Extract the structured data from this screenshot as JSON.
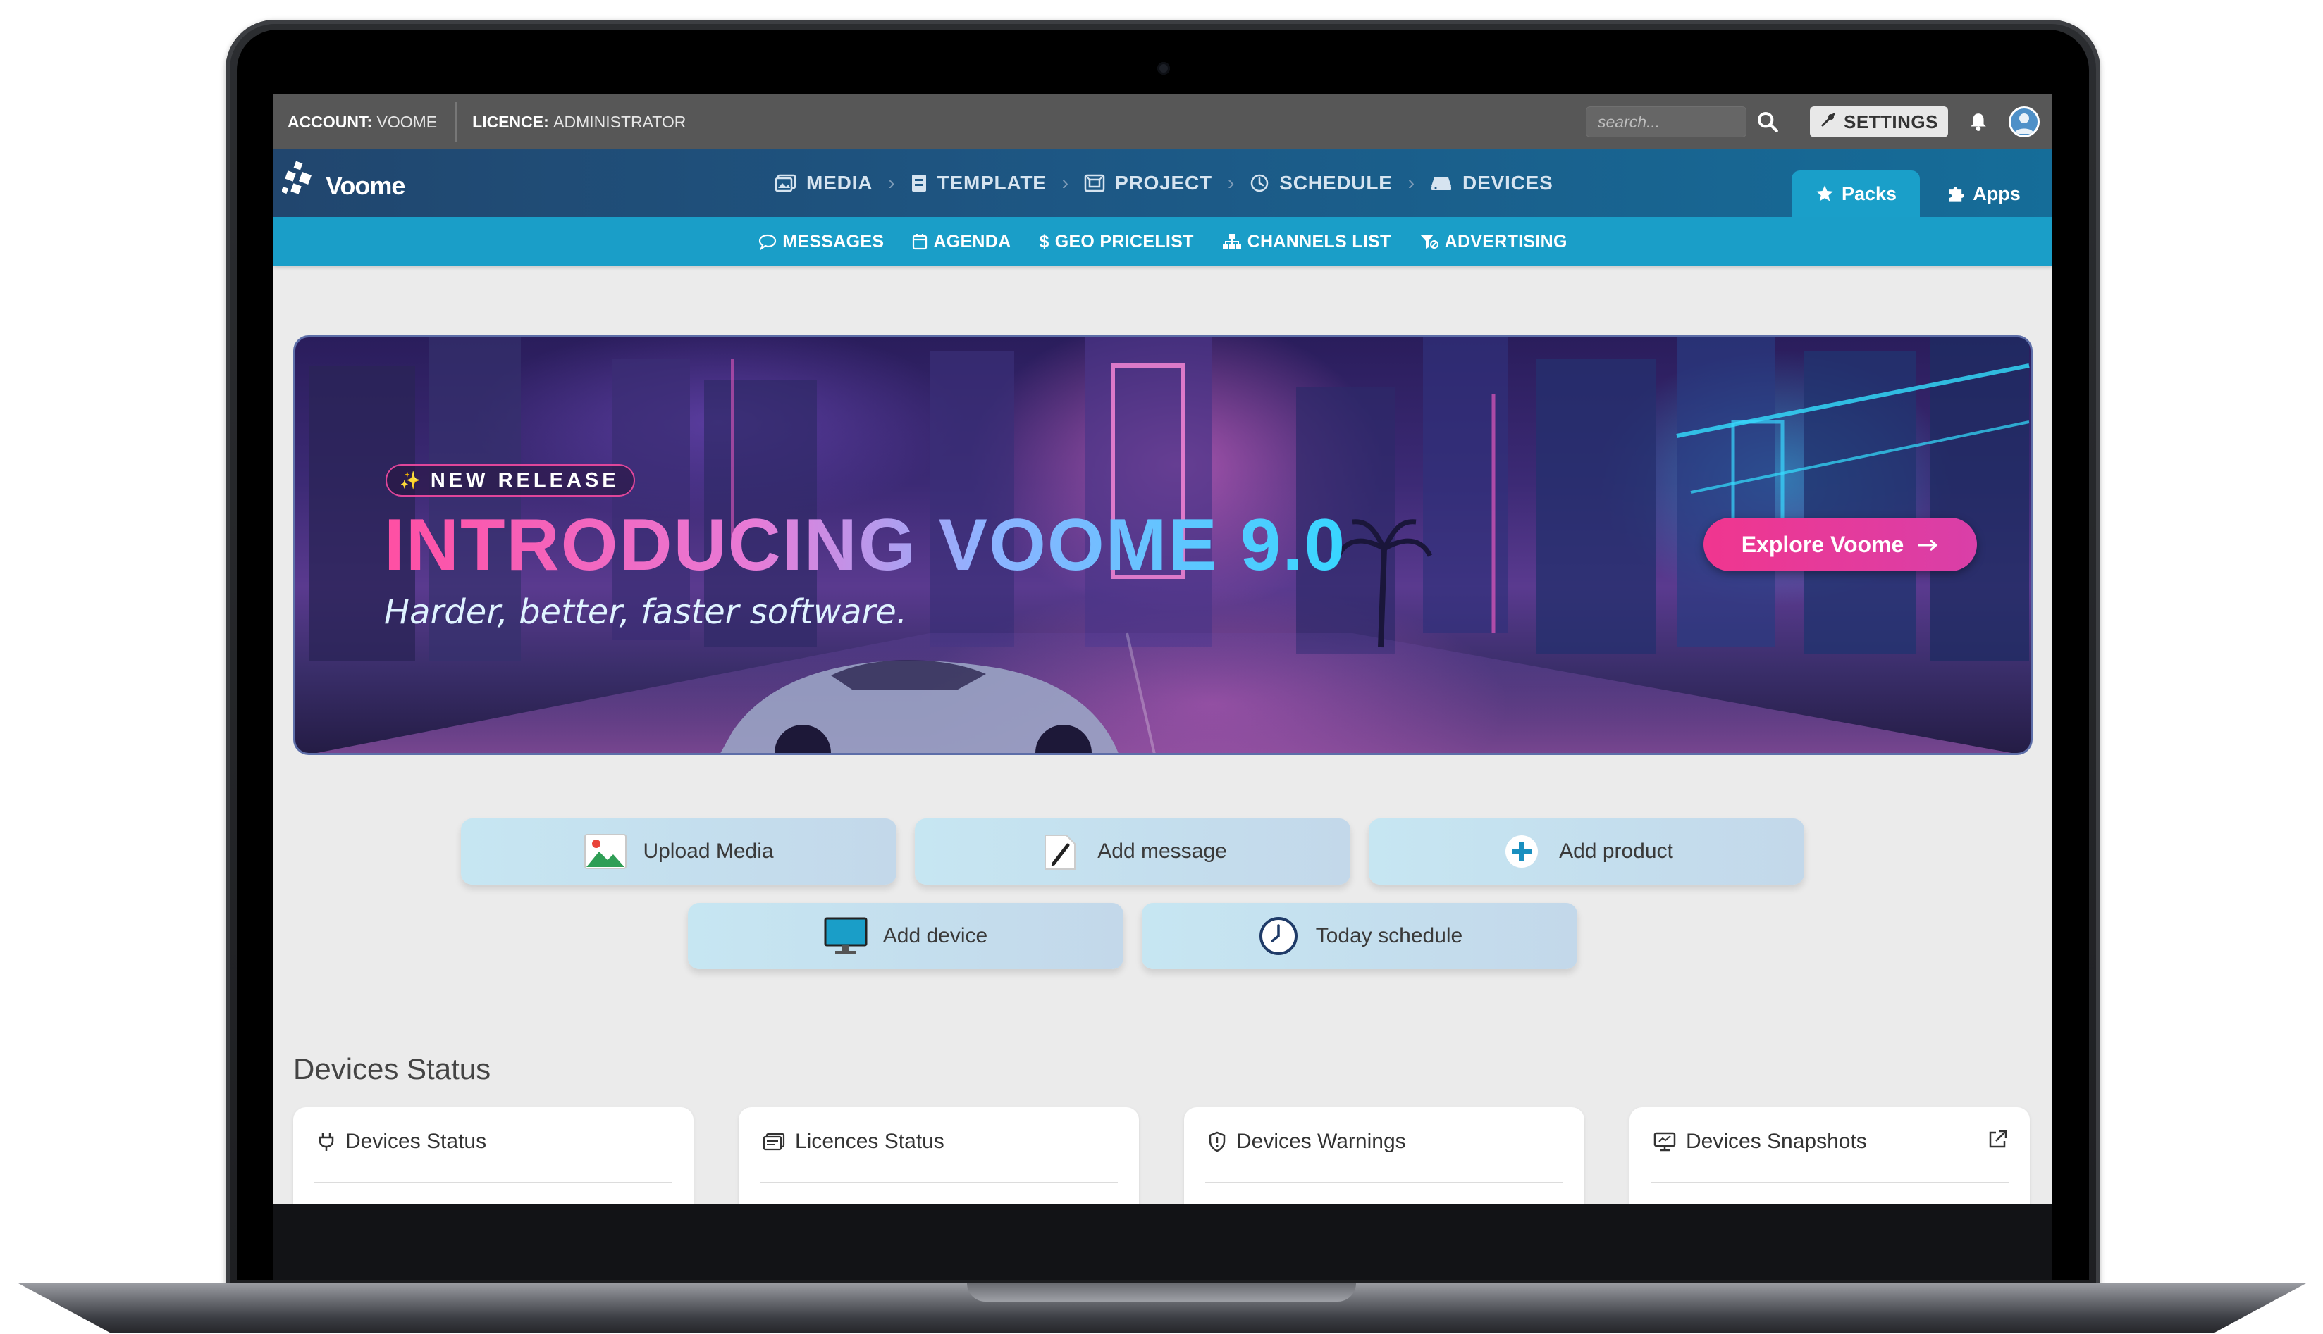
{
  "topbar": {
    "account_label": "ACCOUNT:",
    "account_value": "VOOME",
    "licence_label": "LICENCE:",
    "licence_value": "ADMINISTRATOR",
    "search_placeholder": "search...",
    "settings_label": "SETTINGS"
  },
  "brand": {
    "name": "Voome"
  },
  "main_nav": [
    {
      "label": "MEDIA",
      "icon": "image-icon"
    },
    {
      "label": "TEMPLATE",
      "icon": "template-icon"
    },
    {
      "label": "PROJECT",
      "icon": "project-icon"
    },
    {
      "label": "SCHEDULE",
      "icon": "clock-icon"
    },
    {
      "label": "DEVICES",
      "icon": "device-icon"
    }
  ],
  "tabs": {
    "packs": "Packs",
    "apps": "Apps"
  },
  "sub_nav": [
    {
      "label": "MESSAGES",
      "icon": "chat-bubble-icon"
    },
    {
      "label": "AGENDA",
      "icon": "calendar-icon"
    },
    {
      "label": "GEO PRICELIST",
      "icon": "dollar-icon"
    },
    {
      "label": "CHANNELS LIST",
      "icon": "sitemap-icon"
    },
    {
      "label": "ADVERTISING",
      "icon": "funnel-icon"
    }
  ],
  "hero": {
    "badge": "NEW RELEASE",
    "title": "INTRODUCING VOOME 9.0",
    "subtitle": "Harder, better, faster software.",
    "cta": "Explore Voome"
  },
  "quick_actions": [
    {
      "label": "Upload Media",
      "icon": "landscape-image-icon"
    },
    {
      "label": "Add message",
      "icon": "pencil-icon"
    },
    {
      "label": "Add product",
      "icon": "plus-circle-icon"
    },
    {
      "label": "Add device",
      "icon": "monitor-icon"
    },
    {
      "label": "Today schedule",
      "icon": "clock-icon"
    }
  ],
  "devices_section": {
    "title": "Devices Status",
    "cards": [
      {
        "title": "Devices Status",
        "icon": "plug-icon"
      },
      {
        "title": "Licences Status",
        "icon": "licence-icon"
      },
      {
        "title": "Devices Warnings",
        "icon": "shield-icon"
      },
      {
        "title": "Devices Snapshots",
        "icon": "monitor-icon"
      }
    ]
  },
  "colors": {
    "topbar": "#575757",
    "navbar": "#1d5784",
    "subnav": "#1a9ec8",
    "accent_pink": "#f0368f",
    "page_bg": "#ebebeb"
  }
}
